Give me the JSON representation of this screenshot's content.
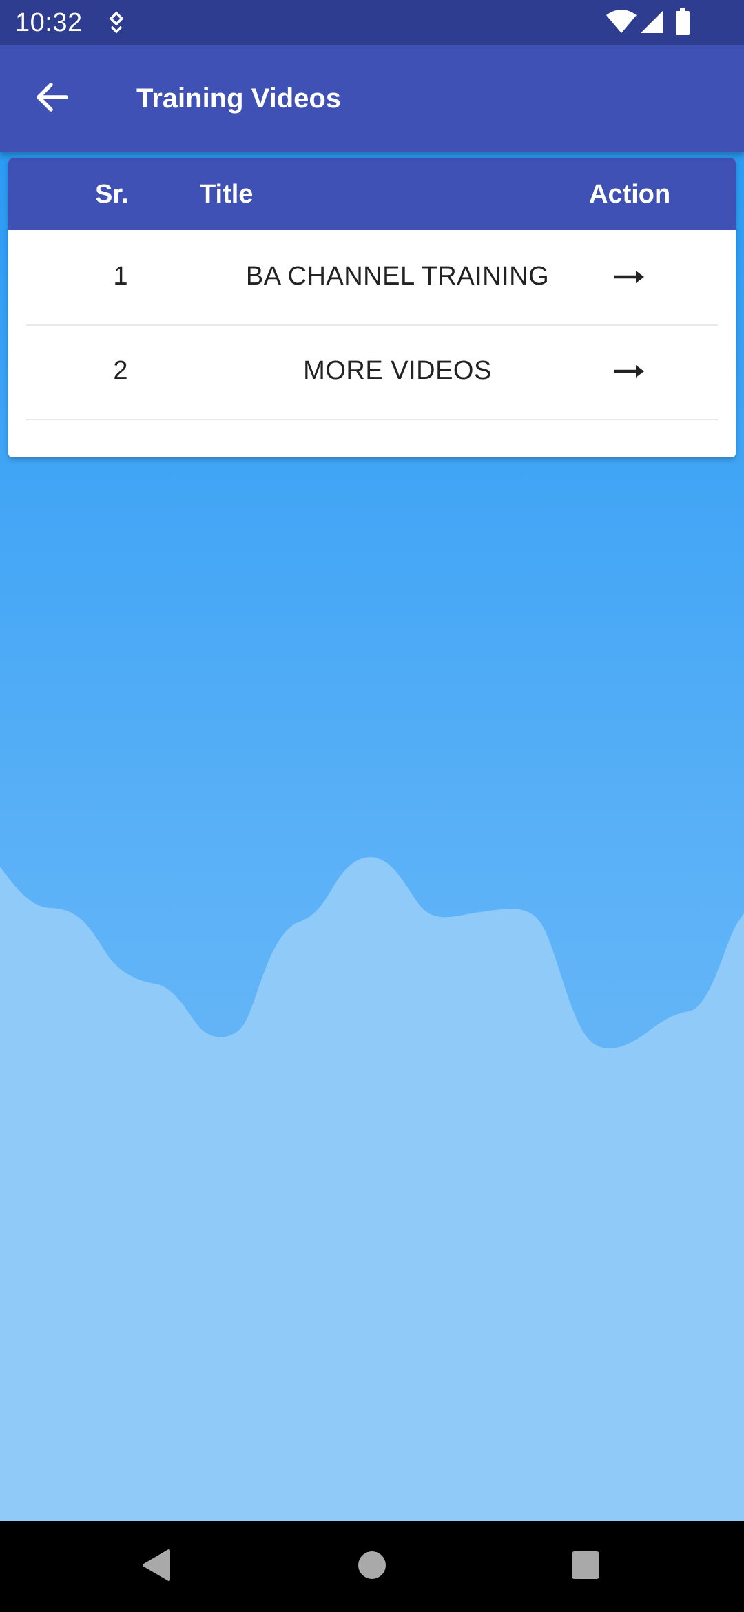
{
  "status_bar": {
    "time": "10:32",
    "icons": [
      "location-pin-icon",
      "wifi-icon",
      "cellular-signal-icon",
      "battery-icon"
    ]
  },
  "app_bar": {
    "title": "Training Videos",
    "back_icon": "arrow-back-icon"
  },
  "table": {
    "headers": {
      "sr": "Sr.",
      "title": "Title",
      "action": "Action"
    },
    "rows": [
      {
        "sr": "1",
        "title": "BA CHANNEL TRAINING",
        "action_icon": "arrow-right-icon"
      },
      {
        "sr": "2",
        "title": "MORE VIDEOS",
        "action_icon": "arrow-right-icon"
      }
    ]
  },
  "nav_bar": {
    "buttons": [
      "back-triangle-icon",
      "home-circle-icon",
      "recents-square-icon"
    ]
  },
  "colors": {
    "status_bar": "#2e3d8f",
    "primary": "#3f51b5",
    "background_top": "#2196F3",
    "wave_light": "#90CAF9",
    "nav_bar": "#000000"
  }
}
